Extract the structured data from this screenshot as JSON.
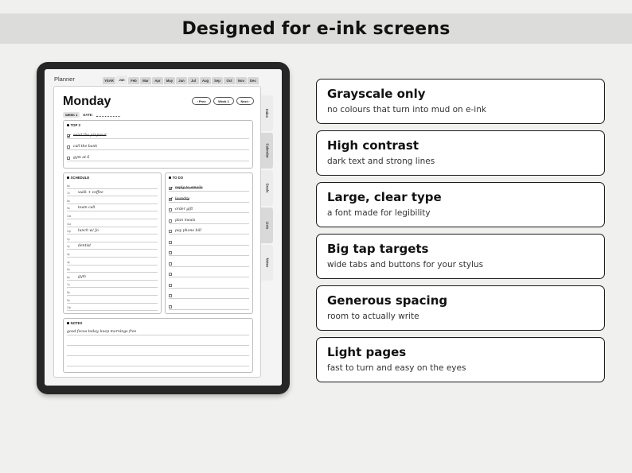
{
  "banner": {
    "title": "Designed for e-ink screens"
  },
  "planner": {
    "app_label": "Planner",
    "months": [
      "YEAR",
      "Jan",
      "Feb",
      "Mar",
      "Apr",
      "May",
      "Jun",
      "Jul",
      "Aug",
      "Sep",
      "Oct",
      "Nov",
      "Dec"
    ],
    "active_month": "Jan",
    "side_tabs": [
      "Index",
      "Calendar",
      "Goals",
      "Lists",
      "Notes"
    ],
    "day": "Monday",
    "week_pill": "WEEK 1",
    "date_label": "DATE:",
    "nav": {
      "prev": "‹ Prev",
      "week": "Week 1",
      "next": "Next ›"
    },
    "top3": {
      "title": "TOP 3",
      "items": [
        {
          "text": "send the proposal",
          "checked": true
        },
        {
          "text": "call the bank",
          "checked": false
        },
        {
          "text": "gym at 6",
          "checked": false
        }
      ]
    },
    "schedule": {
      "title": "SCHEDULE",
      "rows": [
        {
          "hour": "6a",
          "text": ""
        },
        {
          "hour": "7a",
          "text": "walk + coffee"
        },
        {
          "hour": "8a",
          "text": ""
        },
        {
          "hour": "9a",
          "text": "team call"
        },
        {
          "hour": "10a",
          "text": ""
        },
        {
          "hour": "11a",
          "text": ""
        },
        {
          "hour": "12p",
          "text": "lunch w/ Jo"
        },
        {
          "hour": "1p",
          "text": ""
        },
        {
          "hour": "2p",
          "text": "dentist"
        },
        {
          "hour": "3p",
          "text": ""
        },
        {
          "hour": "4p",
          "text": ""
        },
        {
          "hour": "5p",
          "text": ""
        },
        {
          "hour": "6p",
          "text": "gym"
        },
        {
          "hour": "7p",
          "text": ""
        },
        {
          "hour": "8p",
          "text": ""
        },
        {
          "hour": "9p",
          "text": ""
        },
        {
          "hour": "10p",
          "text": ""
        }
      ]
    },
    "todo": {
      "title": "TO DO",
      "items": [
        {
          "text": "reply to emails",
          "checked": true
        },
        {
          "text": "laundry",
          "checked": true
        },
        {
          "text": "order gift",
          "checked": false
        },
        {
          "text": "plan meals",
          "checked": false
        },
        {
          "text": "pay phone bill",
          "checked": false
        },
        {
          "text": "",
          "checked": false
        },
        {
          "text": "",
          "checked": false
        },
        {
          "text": "",
          "checked": false
        },
        {
          "text": "",
          "checked": false
        },
        {
          "text": "",
          "checked": false
        },
        {
          "text": "",
          "checked": false
        },
        {
          "text": "",
          "checked": false
        }
      ]
    },
    "notes": {
      "title": "NOTES",
      "lines": [
        "good focus today, keep mornings free",
        "",
        "",
        ""
      ]
    }
  },
  "features": [
    {
      "title": "Grayscale only",
      "subtitle": "no colours that turn into mud on e-ink"
    },
    {
      "title": "High contrast",
      "subtitle": "dark text and strong lines"
    },
    {
      "title": "Large, clear type",
      "subtitle": "a font made for legibility"
    },
    {
      "title": "Big tap targets",
      "subtitle": "wide tabs and buttons for your stylus"
    },
    {
      "title": "Generous spacing",
      "subtitle": "room to actually write"
    },
    {
      "title": "Light pages",
      "subtitle": "fast to turn and easy on the eyes"
    }
  ]
}
